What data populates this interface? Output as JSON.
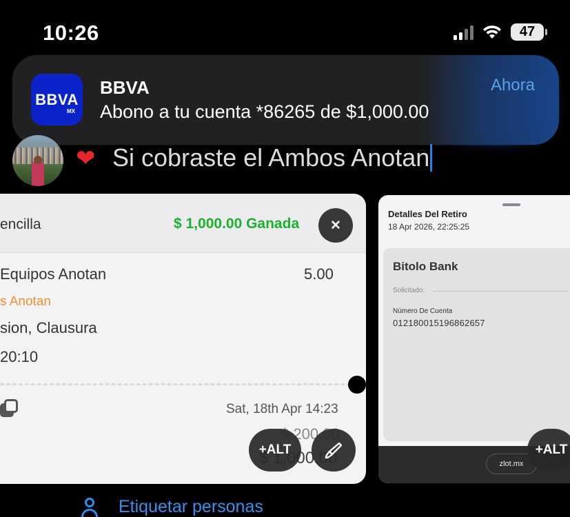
{
  "status_bar": {
    "time": "10:26",
    "battery": "47"
  },
  "notification": {
    "app_name": "BBVA",
    "icon_brand": "BBVA",
    "icon_sub": "MX",
    "message": "Abono a tu cuenta *86265 de $1,000.00",
    "time": "Ahora"
  },
  "post": {
    "caption": "Si cobraste el Ambos Anotan"
  },
  "bet_card": {
    "bet_type": "encilla",
    "result": "$ 1,000.00 Ganada",
    "market": "Equipos Anotan",
    "odds": "5.00",
    "selection": "s Anotan",
    "event": "sion, Clausura",
    "time": "20:10",
    "date": "Sat, 18th Apr 14:23",
    "stake": "$ 200.00",
    "payout": "$ 1,000.00",
    "close_glyph": "✕"
  },
  "withdrawal_card": {
    "title": "Detalles Del Retiro",
    "date": "18 Apr 2026, 22:25:25",
    "bank": "Bitolo Bank",
    "requested_label": "Solicitado:",
    "account_label": "Número De Cuenta",
    "account_number": "012180015196862657",
    "domain": "zlot.mx"
  },
  "buttons": {
    "alt_label": "+ALT"
  },
  "tag_people": {
    "label": "Etiquetar personas"
  },
  "icons": {
    "signal": "cellular-signal-icon",
    "wifi": "wifi-icon",
    "battery": "battery-icon",
    "heart": "heart-emoji",
    "close": "close-icon",
    "copy": "copy-icon",
    "edit": "brush-icon",
    "person": "person-icon"
  },
  "colors": {
    "bbva_blue": "#0a24c9",
    "win_green": "#1fae2e",
    "selection_orange": "#f09033",
    "link_blue": "#3b8fe8"
  }
}
